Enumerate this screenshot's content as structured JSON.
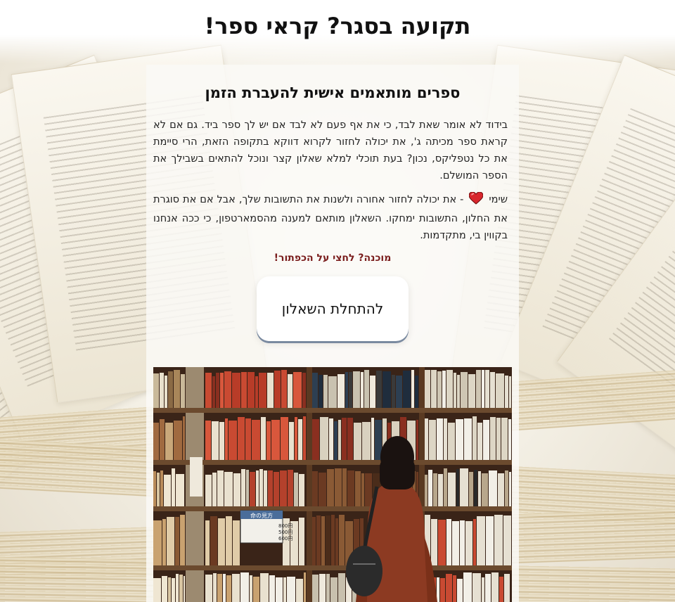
{
  "page": {
    "title": "תקועה בסגר? קראי ספר!"
  },
  "card": {
    "heading": "ספרים מותאמים אישית להעברת הזמן",
    "paragraph1": "בידוד לא אומר שאת לבד, כי את אף פעם לא לבד אם יש לך ספר ביד. גם אם לא קראת ספר מכיתה ג', את יכולה לחזור לקרוא דווקא בתקופה הזאת, הרי סיימת את כל נטפליקס, נכון? בעת תוכלי למלא שאלון קצר ונוכל להתאים בשבילך את הספר המושלם.",
    "paragraph2_before": "שימי",
    "paragraph2_after": "- את יכולה לחזור אחורה ולשנות את התשובות שלך, אבל אם את סוגרת את החלון, התשובות ימחקו. השאלון מותאם למענה מהסמארטפון, כי ככה אנחנו בקווין בי, מתקדמות.",
    "cta_note": "מוכנה? לחצי על הכפתור!",
    "start_button": "להתחלת השאלון"
  },
  "icons": {
    "heart": "heart-icon"
  },
  "colors": {
    "heart": "#d8262c",
    "cta_note": "#7a1d1d",
    "button_shadow": "#7a8aa0"
  },
  "photo": {
    "sign_label": "命の見方",
    "price_lines": [
      "800円",
      "500円",
      "600円"
    ],
    "side_label": "時間 カメラ 会館"
  }
}
